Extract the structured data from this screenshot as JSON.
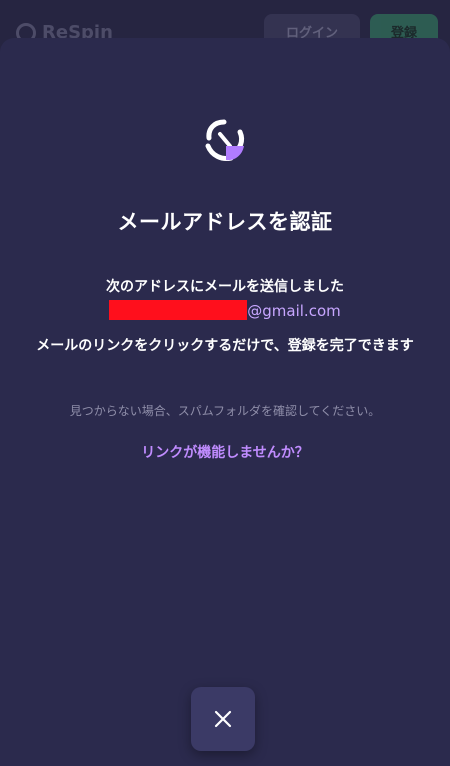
{
  "background": {
    "logo_text": "ReSpin",
    "login_label": "ログイン",
    "register_label": "登録"
  },
  "modal": {
    "title": "メールアドレスを認証",
    "sent_message": "次のアドレスにメールを送信しました",
    "email_domain": "@gmail.com",
    "instruction": "メールのリンクをクリックするだけで、登録を完了できます",
    "spam_note": "見つからない場合、スパムフォルダを確認してください。",
    "link_trouble": "リンクが機能しませんか？"
  },
  "colors": {
    "background": "#2b2a4d",
    "accent": "#c08cff",
    "redaction": "#ff0f1c",
    "close_button": "#3b3a66"
  },
  "icons": {
    "brand": "brand-swirl-icon",
    "close": "close-icon"
  }
}
